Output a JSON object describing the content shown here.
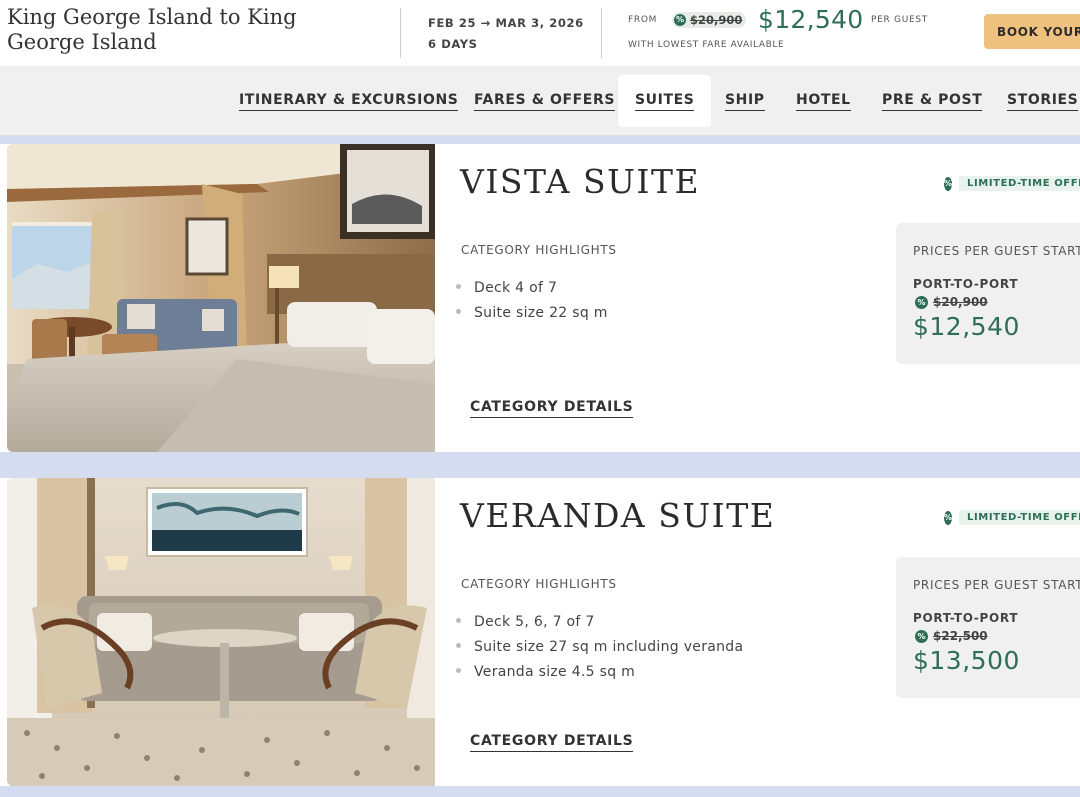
{
  "header": {
    "title": "King George Island to King George Island",
    "dates": "FEB 25 → MAR 3, 2026",
    "duration": "6 DAYS",
    "from_label": "FROM",
    "old_price": "$20,900",
    "price": "$12,540",
    "per_guest": "PER GUEST",
    "lowest_note": "WITH LOWEST FARE AVAILABLE",
    "book_label": "BOOK YOUR",
    "accent_color": "#2e6e57",
    "button_color": "#eec17e"
  },
  "nav": {
    "items": [
      {
        "label": "ITINERARY & EXCURSIONS"
      },
      {
        "label": "FARES & OFFERS"
      },
      {
        "label": "SUITES",
        "active": true
      },
      {
        "label": "SHIP"
      },
      {
        "label": "HOTEL"
      },
      {
        "label": "PRE & POST"
      },
      {
        "label": "STORIES"
      }
    ]
  },
  "suites": [
    {
      "name": "VISTA SUITE",
      "badge": "LIMITED-TIME OFFER",
      "highlights_title": "CATEGORY HIGHLIGHTS",
      "highlights": [
        "Deck 4 of 7",
        "Suite size 22 sq m"
      ],
      "details_label": "CATEGORY DETAILS",
      "price_title": "PRICES PER GUEST STARTING",
      "fare_type": "PORT-TO-PORT",
      "old_price": "$20,900",
      "price": "$12,540"
    },
    {
      "name": "VERANDA SUITE",
      "badge": "LIMITED-TIME OFFER",
      "highlights_title": "CATEGORY HIGHLIGHTS",
      "highlights": [
        "Deck 5, 6, 7 of 7",
        "Suite size 27 sq m including veranda",
        "Veranda size 4.5 sq m"
      ],
      "details_label": "CATEGORY DETAILS",
      "price_title": "PRICES PER GUEST STARTING",
      "fare_type": "PORT-TO-PORT",
      "old_price": "$22,500",
      "price": "$13,500"
    }
  ],
  "icons": {
    "discount": "percent-icon"
  }
}
